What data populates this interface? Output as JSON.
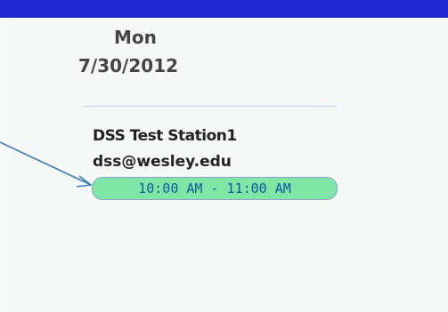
{
  "calendar": {
    "day_name": "Mon",
    "date": "7/30/2012"
  },
  "appointment": {
    "station": "DSS Test Station1",
    "email": "dss@wesley.edu",
    "time_range": "10:00 AM - 11:00 AM"
  },
  "colors": {
    "top_bar": "#2228d0",
    "slot_fill": "#7fe6a6",
    "slot_text": "#0b5a9f",
    "arrow": "#3b7cc0"
  },
  "icons": {
    "annotation": "arrow-icon"
  }
}
